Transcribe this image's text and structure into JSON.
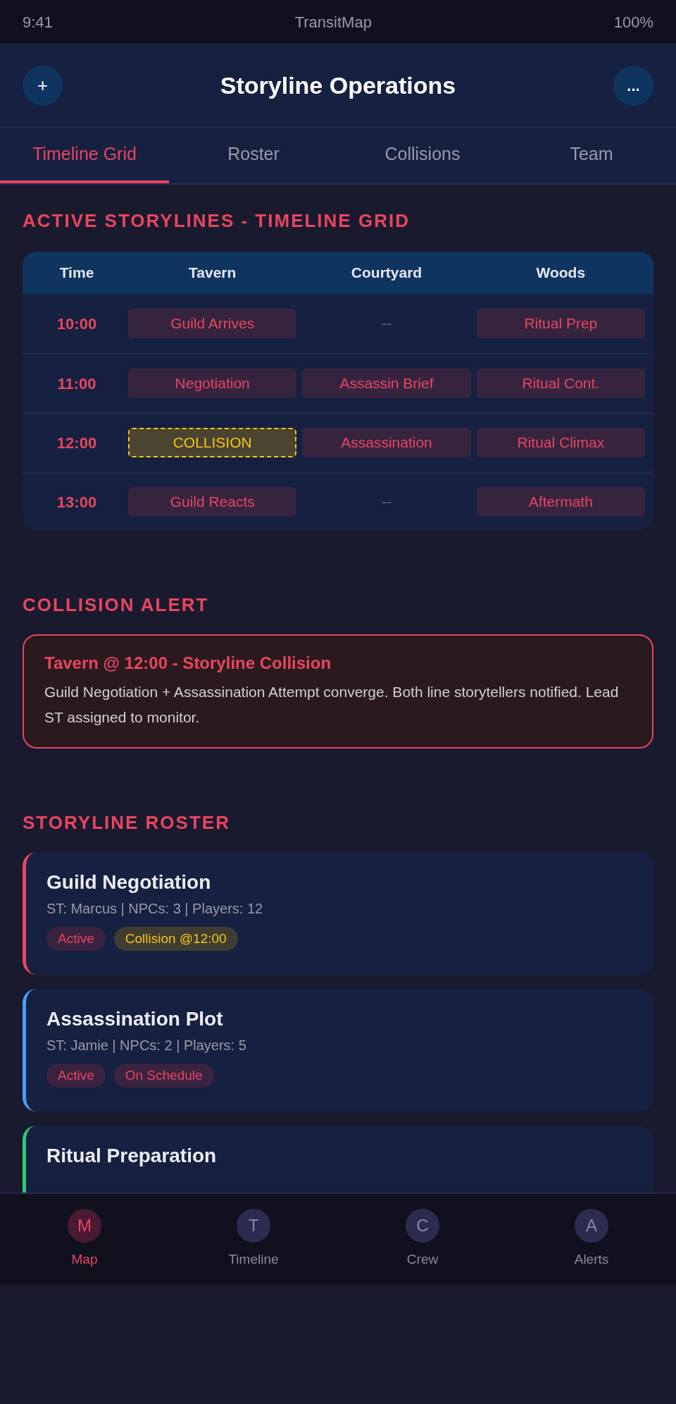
{
  "status_bar": {
    "time": "9:41",
    "app": "TransitMap",
    "battery": "100%"
  },
  "header": {
    "left_button": "+",
    "title": "Storyline Operations",
    "right_button": "..."
  },
  "tabs": [
    {
      "label": "Timeline Grid",
      "selected": true
    },
    {
      "label": "Roster",
      "selected": false
    },
    {
      "label": "Collisions",
      "selected": false
    },
    {
      "label": "Team",
      "selected": false
    }
  ],
  "timeline": {
    "title": "ACTIVE STORYLINES - TIMELINE GRID",
    "columns": [
      "Time",
      "Tavern",
      "Courtyard",
      "Woods"
    ],
    "rows": [
      {
        "cells": [
          {
            "kind": "time",
            "text": "10:00"
          },
          {
            "kind": "event",
            "text": "Guild Arrives"
          },
          {
            "kind": "empty",
            "text": "--"
          },
          {
            "kind": "event",
            "text": "Ritual Prep"
          }
        ]
      },
      {
        "cells": [
          {
            "kind": "time",
            "text": "11:00"
          },
          {
            "kind": "event",
            "text": "Negotiation"
          },
          {
            "kind": "event",
            "text": "Assassin Brief"
          },
          {
            "kind": "event",
            "text": "Ritual Cont."
          }
        ]
      },
      {
        "cells": [
          {
            "kind": "time",
            "text": "12:00"
          },
          {
            "kind": "collision",
            "text": "COLLISION"
          },
          {
            "kind": "event",
            "text": "Assassination"
          },
          {
            "kind": "event",
            "text": "Ritual Climax"
          }
        ]
      },
      {
        "cells": [
          {
            "kind": "time",
            "text": "13:00"
          },
          {
            "kind": "event",
            "text": "Guild Reacts"
          },
          {
            "kind": "empty",
            "text": "--"
          },
          {
            "kind": "event",
            "text": "Aftermath"
          }
        ]
      }
    ]
  },
  "alert": {
    "title": "COLLISION ALERT",
    "heading": "Tavern @ 12:00 - Storyline Collision",
    "body": "Guild Negotiation + Assassination Attempt converge. Both line storytellers notified. Lead ST assigned to monitor."
  },
  "roster": {
    "title": "STORYLINE ROSTER",
    "items": [
      {
        "name": "Guild Negotiation",
        "meta": "ST: Marcus | NPCs: 3 | Players: 12",
        "color": "#e94560",
        "tags": [
          {
            "kind": "status",
            "text": "Active"
          },
          {
            "kind": "warning",
            "text": "Collision @12:00"
          }
        ]
      },
      {
        "name": "Assassination Plot",
        "meta": "ST: Jamie | NPCs: 2 | Players: 5",
        "color": "#4a9eff",
        "tags": [
          {
            "kind": "status",
            "text": "Active"
          },
          {
            "kind": "status",
            "text": "On Schedule"
          }
        ]
      },
      {
        "name": "Ritual Preparation",
        "color": "#2ecc71"
      }
    ]
  },
  "bottom_nav": [
    {
      "icon": "M",
      "label": "Map",
      "selected": true
    },
    {
      "icon": "T",
      "label": "Timeline",
      "selected": false
    },
    {
      "icon": "C",
      "label": "Crew",
      "selected": false
    },
    {
      "icon": "A",
      "label": "Alerts",
      "selected": false
    }
  ]
}
